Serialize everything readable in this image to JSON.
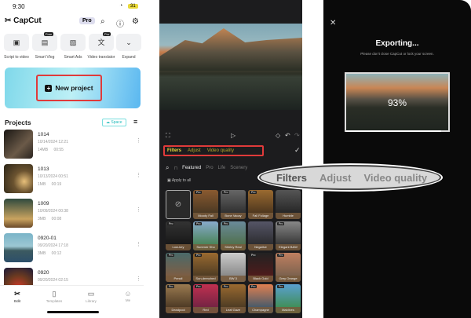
{
  "home": {
    "time": "9:30",
    "battery": "31",
    "app_name": "CapCut",
    "pro_label": "Pro",
    "tools": [
      {
        "label": "Script to video",
        "icon": "script-icon"
      },
      {
        "label": "Smart Vlog",
        "icon": "vlog-icon",
        "badge": "Free"
      },
      {
        "label": "Smart Ads",
        "icon": "ads-icon"
      },
      {
        "label": "Video translator",
        "icon": "translate-icon",
        "badge": "Pro"
      },
      {
        "label": "Expand",
        "icon": "chevron-down-icon"
      }
    ],
    "new_project": "New project",
    "projects_title": "Projects",
    "space_label": "Space",
    "projects": [
      {
        "name": "1014",
        "date": "10/14/2024 12:21",
        "size": "14MB",
        "duration": "00:55"
      },
      {
        "name": "1013",
        "date": "10/13/2024 00:51",
        "size": "1MB",
        "duration": "00:19"
      },
      {
        "name": "1009",
        "date": "10/09/2024 00:38",
        "size": "3MB",
        "duration": "00:08"
      },
      {
        "name": "0920-01",
        "date": "09/20/2024 17:18",
        "size": "3MB",
        "duration": "00:12"
      },
      {
        "name": "0920",
        "date": "09/20/2024 02:15",
        "size": "",
        "duration": ""
      }
    ],
    "nav": [
      "Edit",
      "Templates",
      "Library",
      "Me"
    ]
  },
  "editor": {
    "tabs": [
      "Filters",
      "Adjust",
      "Video quality"
    ],
    "categories": [
      "Featured",
      "Pro",
      "Life",
      "Scenery"
    ],
    "apply_all": "Apply to all",
    "pro_badge": "Pro",
    "filters": [
      "Moody Fall",
      "Bone Vacay",
      "Fall Foliage",
      "Humble",
      "Low-key",
      "Summer Sho",
      "Shirley Real",
      "Negative",
      "Elegant B&W",
      "Pencil",
      "Sun-drenched",
      "BW 3",
      "Black Gold",
      "Grey Orange",
      "Deadpool",
      "Red",
      "Leaf Gaze",
      "Champagne",
      "Maldives"
    ],
    "magnified_tabs": [
      "Filters",
      "Adjust",
      "Video quality"
    ]
  },
  "export": {
    "title": "Exporting...",
    "subtitle": "Please don't close CapCut or lock your screen.",
    "progress_label": "93%",
    "progress": 93
  },
  "colors": {
    "accent": "#e8d83a",
    "highlight": "#e03a3a"
  }
}
